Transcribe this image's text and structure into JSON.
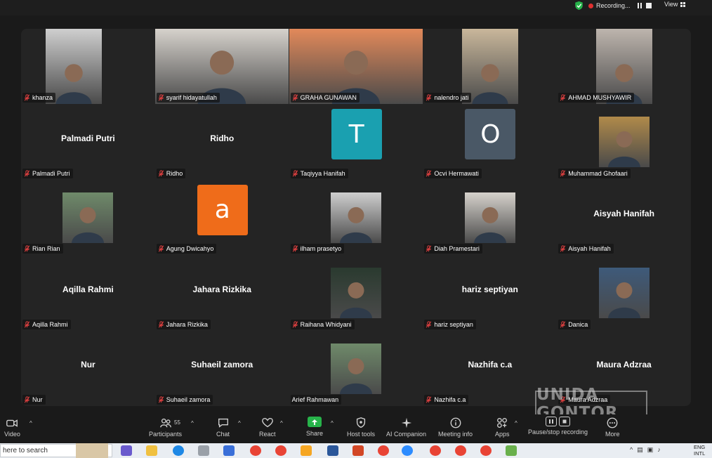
{
  "top_bar": {
    "recording_label": "Recording...",
    "view_label": "View"
  },
  "participants": [
    {
      "name": "khanza",
      "display": "photo"
    },
    {
      "name": "syarif hidayatullah",
      "display": "photo"
    },
    {
      "name": "GRAHA GUNAWAN",
      "display": "photo"
    },
    {
      "name": "nalendro jati",
      "display": "photo"
    },
    {
      "name": "AHMAD MUSHYAWIR",
      "display": "photo"
    },
    {
      "name": "Palmadi Putri",
      "display": "name",
      "big_name": "Palmadi Putri"
    },
    {
      "name": "Ridho",
      "display": "name",
      "big_name": "Ridho"
    },
    {
      "name": "Taqiyya Hanifah",
      "display": "letter",
      "letter": "T",
      "color": "#1aa0b0"
    },
    {
      "name": "Ocvi Hermawati",
      "display": "letter",
      "letter": "O",
      "color": "#4a5866"
    },
    {
      "name": "Muhammad Ghofaari",
      "display": "photo"
    },
    {
      "name": "Rian Rian",
      "display": "photo"
    },
    {
      "name": "Agung Dwicahyo",
      "display": "letter",
      "letter": "a",
      "color": "#ef6c1a"
    },
    {
      "name": "ilham prasetyo",
      "display": "photo"
    },
    {
      "name": "Diah Pramestari",
      "display": "photo"
    },
    {
      "name": "Aisyah Hanifah",
      "display": "name",
      "big_name": "Aisyah Hanifah"
    },
    {
      "name": "Aqilla Rahmi",
      "display": "name",
      "big_name": "Aqilla Rahmi"
    },
    {
      "name": "Jahara Rizkika",
      "display": "name",
      "big_name": "Jahara Rizkika"
    },
    {
      "name": "Raihana Whidyani",
      "display": "photo"
    },
    {
      "name": "hariz septiyan",
      "display": "name",
      "big_name": "hariz septiyan"
    },
    {
      "name": "Danica",
      "display": "photo"
    },
    {
      "name": "Nur",
      "display": "name",
      "big_name": "Nur"
    },
    {
      "name": "Suhaeil zamora",
      "display": "name",
      "big_name": "Suhaeil zamora"
    },
    {
      "name": "Arief Rahmawan",
      "display": "photo"
    },
    {
      "name": "Nazhifa c.a",
      "display": "name",
      "big_name": "Nazhifa c.a"
    },
    {
      "name": "Maura Adzraa",
      "display": "name",
      "big_name": "Maura Adzraa"
    }
  ],
  "toolbar": {
    "video": "Video",
    "participants": "Participants",
    "participants_count": "55",
    "chat": "Chat",
    "react": "React",
    "share": "Share",
    "host_tools": "Host tools",
    "ai_companion": "AI Companion",
    "meeting_info": "Meeting info",
    "apps": "Apps",
    "pause_stop_recording": "Pause/stop recording",
    "more": "More"
  },
  "watermark": "UNIDA GONTOR",
  "taskbar": {
    "search_placeholder": "here to search",
    "lang_top": "ENG",
    "lang_bottom": "INTL"
  },
  "colors": {
    "share_green": "#27b34a",
    "gallery_bg": "#242424",
    "recording_red": "#e03030"
  }
}
